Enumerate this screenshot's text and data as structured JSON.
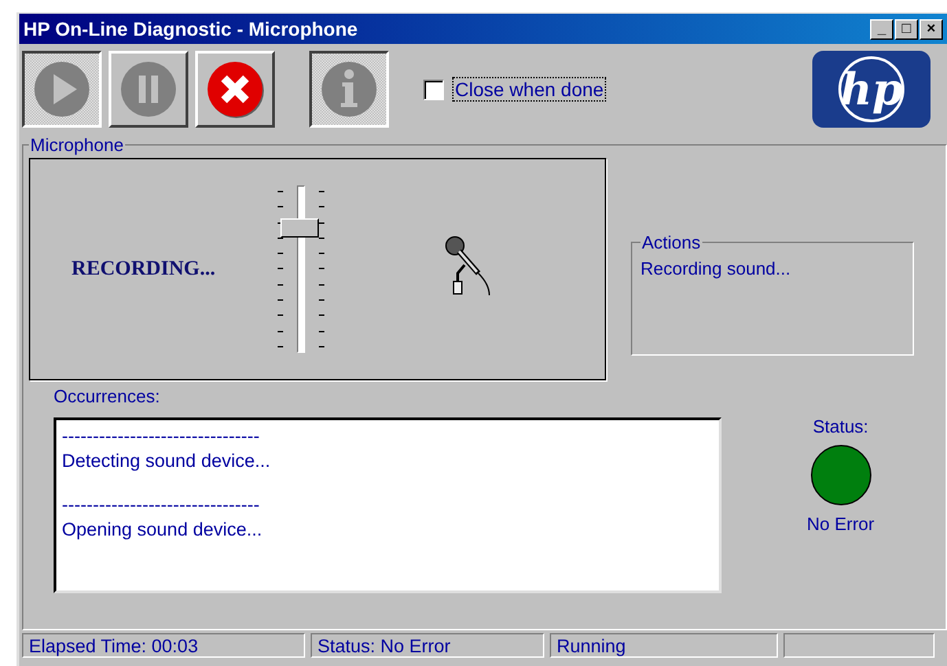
{
  "window": {
    "title": "HP On-Line Diagnostic - Microphone",
    "controls": [
      "_",
      "□",
      "×"
    ]
  },
  "toolbar": [
    {
      "kind": "play",
      "disabled": true,
      "pressed": true
    },
    {
      "kind": "pause",
      "disabled": true,
      "pressed": false
    },
    {
      "kind": "stop",
      "disabled": false,
      "pressed": false
    },
    {
      "kind": "info",
      "disabled": true,
      "pressed": true
    }
  ],
  "close_when_done": {
    "label": "Close when done",
    "checked": false
  },
  "logo": {
    "text": "hp"
  },
  "microphone": {
    "title": "Microphone",
    "state_text": "RECORDING...",
    "volume": {
      "level": 0.75
    }
  },
  "actions": {
    "title": "Actions",
    "text": "Recording sound..."
  },
  "occurrences": {
    "label": "Occurrences:",
    "entries": [
      {
        "separator": "--------------------------------",
        "text": "Detecting sound device..."
      },
      {
        "separator": "--------------------------------",
        "text": "Opening sound device..."
      }
    ]
  },
  "status": {
    "label": "Status:",
    "color": "#007f0e",
    "text": "No Error"
  },
  "status_bar": [
    "Elapsed Time: 00:03",
    "Status: No Error",
    "Running"
  ]
}
